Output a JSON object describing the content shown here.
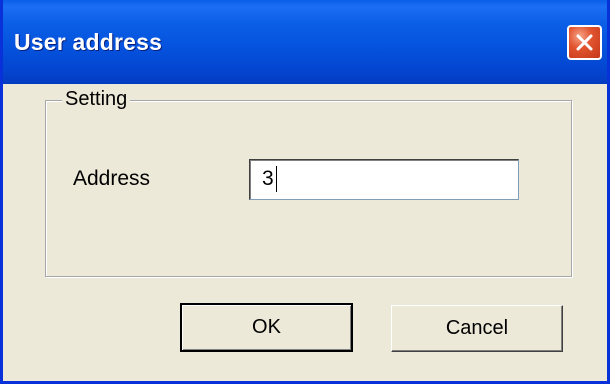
{
  "window": {
    "title": "User address",
    "close_icon": "close-x-icon"
  },
  "group": {
    "label": "Setting"
  },
  "address": {
    "label": "Address",
    "value": "3"
  },
  "buttons": {
    "ok_label": "OK",
    "cancel_label": "Cancel"
  },
  "colors": {
    "titlebar": "#0553de",
    "dialog_bg": "#ece9d8",
    "close_button": "#e2552f"
  }
}
